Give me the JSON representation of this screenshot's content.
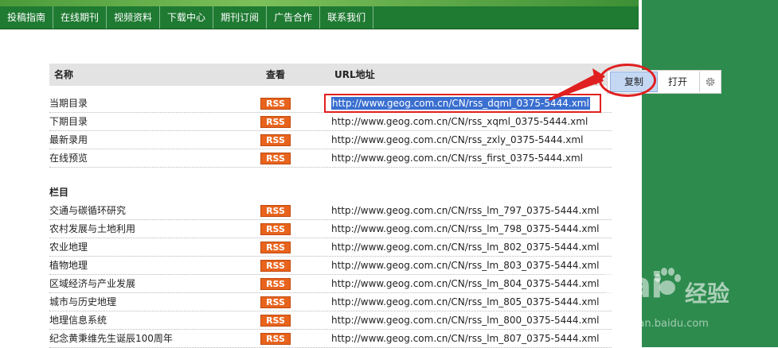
{
  "nav": [
    "投稿指南",
    "在线期刊",
    "视频资料",
    "下载中心",
    "期刊订阅",
    "广告合作",
    "联系我们"
  ],
  "table": {
    "col_name": "名称",
    "col_view": "查看",
    "col_url": "URL地址"
  },
  "rss_label": "RSS",
  "rows_top": [
    {
      "name": "当期目录",
      "url": "http://www.geog.com.cn/CN/rss_dqml_0375-5444.xml"
    },
    {
      "name": "下期目录",
      "url": "http://www.geog.com.cn/CN/rss_xqml_0375-5444.xml"
    },
    {
      "name": "最新录用",
      "url": "http://www.geog.com.cn/CN/rss_zxly_0375-5444.xml"
    },
    {
      "name": "在线预览",
      "url": "http://www.geog.com.cn/CN/rss_first_0375-5444.xml"
    }
  ],
  "section_title": "栏目",
  "rows_columns": [
    {
      "name": "交通与碳循环研究",
      "url": "http://www.geog.com.cn/CN/rss_lm_797_0375-5444.xml"
    },
    {
      "name": "农村发展与土地利用",
      "url": "http://www.geog.com.cn/CN/rss_lm_798_0375-5444.xml"
    },
    {
      "name": "农业地理",
      "url": "http://www.geog.com.cn/CN/rss_lm_802_0375-5444.xml"
    },
    {
      "name": "植物地理",
      "url": "http://www.geog.com.cn/CN/rss_lm_803_0375-5444.xml"
    },
    {
      "name": "区域经济与产业发展",
      "url": "http://www.geog.com.cn/CN/rss_lm_804_0375-5444.xml"
    },
    {
      "name": "城市与历史地理",
      "url": "http://www.geog.com.cn/CN/rss_lm_805_0375-5444.xml"
    },
    {
      "name": "地理信息系统",
      "url": "http://www.geog.com.cn/CN/rss_lm_800_0375-5444.xml"
    },
    {
      "name": "纪念黄秉维先生诞辰100周年",
      "url": "http://www.geog.com.cn/CN/rss_lm_807_0375-5444.xml"
    }
  ],
  "toolbar": {
    "copy_label": "复制",
    "open_label": "打开",
    "gear_icon": "gear-icon"
  },
  "watermark": {
    "logo_text": "Bai",
    "jy_text": "经验",
    "url_text": "jingyan.baidu.com"
  },
  "colors": {
    "nav_green": "#1f7a32",
    "side_green": "#2e8b4e",
    "rss_orange": "#e8631c",
    "annotation_red": "#e02020",
    "selection_blue": "#3a6fd0"
  }
}
